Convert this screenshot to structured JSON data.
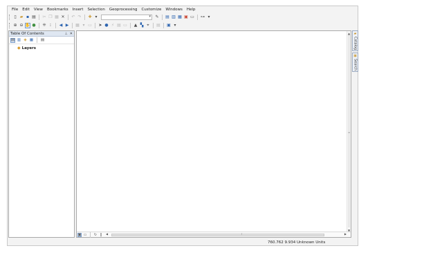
{
  "menubar": {
    "items": [
      "File",
      "Edit",
      "View",
      "Bookmarks",
      "Insert",
      "Selection",
      "Geoprocessing",
      "Customize",
      "Windows",
      "Help"
    ]
  },
  "toc": {
    "title": "Table Of Contents",
    "pin_glyph": "⊥",
    "close_glyph": "✕",
    "root_layer": "Layers"
  },
  "dock": {
    "tabs": [
      "Catalog",
      "Search"
    ]
  },
  "statusbar": {
    "coordinates": "760.762  9.934 Unknown Units"
  }
}
